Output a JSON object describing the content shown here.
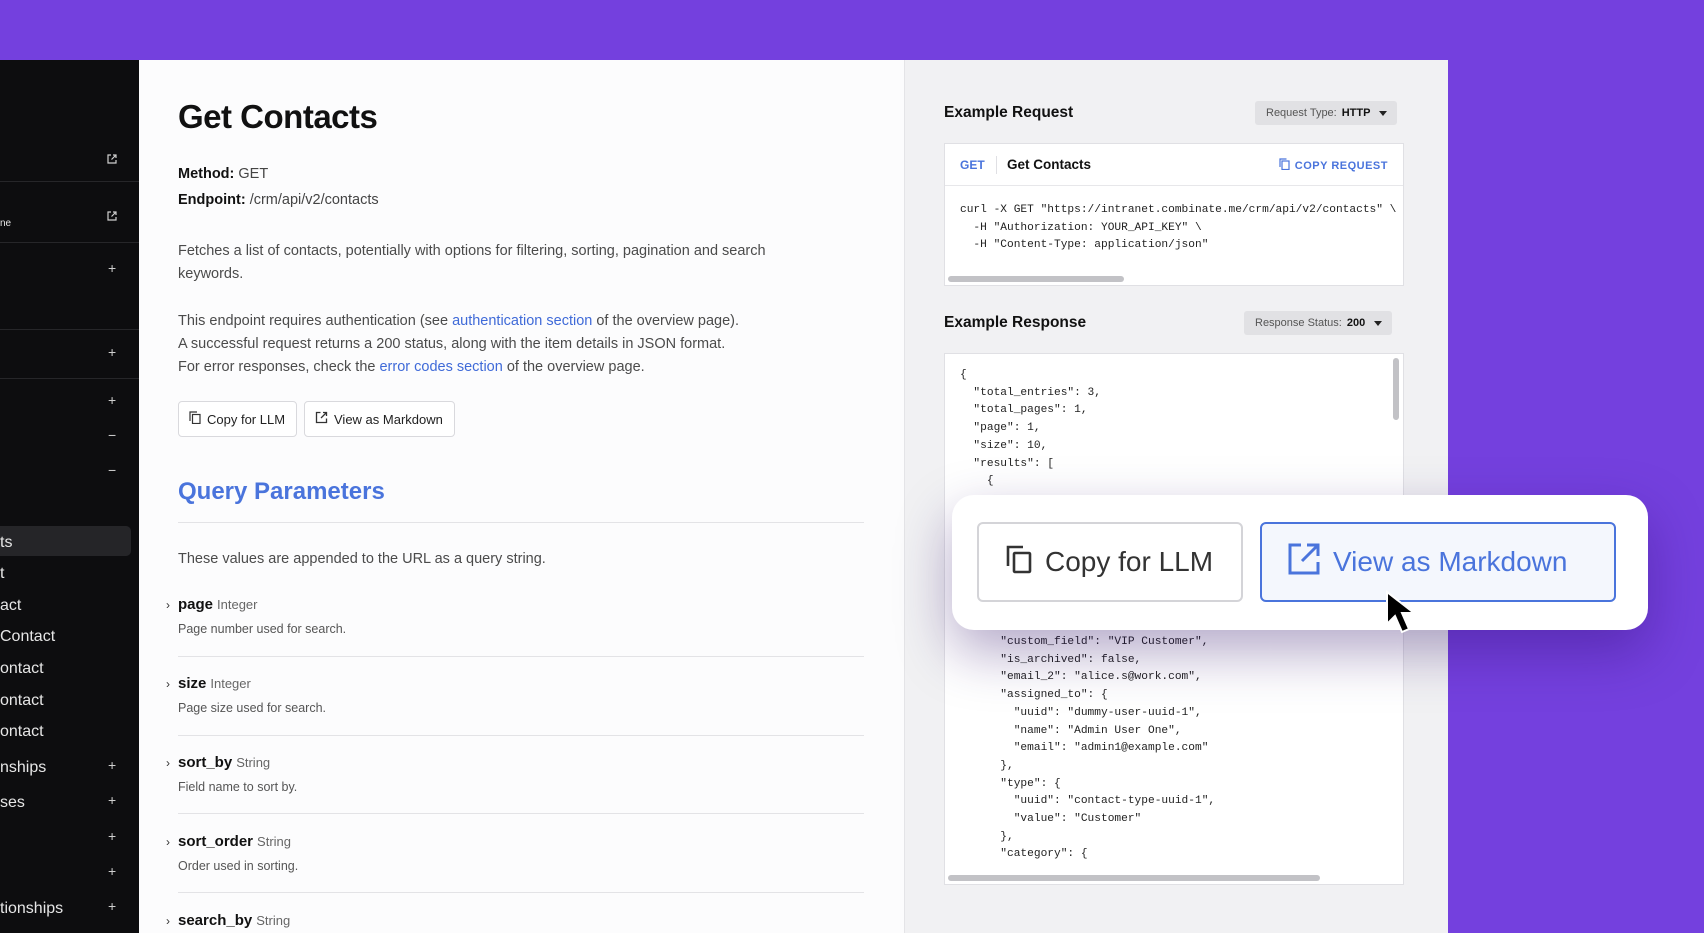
{
  "sidebar": {
    "items": [
      {
        "label": "ts"
      },
      {
        "label": "t"
      },
      {
        "label": "act"
      },
      {
        "label": "Contact"
      },
      {
        "label": "ontact"
      },
      {
        "label": "ontact"
      },
      {
        "label": "ontact"
      },
      {
        "label": "nships"
      },
      {
        "label": "ses"
      },
      {
        "label": "tionships"
      }
    ],
    "clipped_label": "ne",
    "plus": "+",
    "minus": "−"
  },
  "main": {
    "title": "Get Contacts",
    "method_label": "Method:",
    "method_value": "GET",
    "endpoint_label": "Endpoint:",
    "endpoint_value": "/crm/api/v2/contacts",
    "description": "Fetches a list of contacts, potentially with options for filtering, sorting, pagination and search keywords.",
    "auth_prefix": "This endpoint requires authentication (see ",
    "auth_link": "authentication section",
    "auth_suffix": " of the overview page).",
    "success_text": "A successful request returns a 200 status, along with the item details in JSON format.",
    "error_prefix": "For error responses, check the ",
    "error_link": "error codes section",
    "error_suffix": " of the overview page.",
    "copy_llm_label": "Copy for LLM",
    "view_md_label": "View as Markdown",
    "query_heading": "Query Parameters",
    "query_intro": "These values are appended to the URL as a query string.",
    "params": [
      {
        "name": "page",
        "type": "Integer",
        "desc": "Page number used for search."
      },
      {
        "name": "size",
        "type": "Integer",
        "desc": "Page size used for search."
      },
      {
        "name": "sort_by",
        "type": "String",
        "desc": "Field name to sort by."
      },
      {
        "name": "sort_order",
        "type": "String",
        "desc": "Order used in sorting."
      },
      {
        "name": "search_by",
        "type": "String",
        "desc": ""
      }
    ]
  },
  "request": {
    "heading": "Example Request",
    "type_label": "Request Type:",
    "type_value": "HTTP",
    "method": "GET",
    "name": "Get Contacts",
    "copy_label": "COPY REQUEST",
    "code": "curl -X GET \"https://intranet.combinate.me/crm/api/v2/contacts\" \\\n  -H \"Authorization: YOUR_API_KEY\" \\\n  -H \"Content-Type: application/json\""
  },
  "response": {
    "heading": "Example Response",
    "status_label": "Response Status:",
    "status_value": "200",
    "code_top": "{\n  \"total_entries\": 3,\n  \"total_pages\": 1,\n  \"page\": 1,\n  \"size\": 10,\n  \"results\": [\n    {",
    "code_bottom": "      \"custom_field\": \"VIP Customer\",\n      \"is_archived\": false,\n      \"email_2\": \"alice.s@work.com\",\n      \"assigned_to\": {\n        \"uuid\": \"dummy-user-uuid-1\",\n        \"name\": \"Admin User One\",\n        \"email\": \"admin1@example.com\"\n      },\n      \"type\": {\n        \"uuid\": \"contact-type-uuid-1\",\n        \"value\": \"Customer\"\n      },\n      \"category\": {"
  },
  "popup": {
    "copy_llm_label": "Copy for LLM",
    "view_md_label": "View as Markdown"
  },
  "colors": {
    "background": "#7440DE",
    "accent": "#4A74DC",
    "sidebar": "#0D0D0F"
  }
}
